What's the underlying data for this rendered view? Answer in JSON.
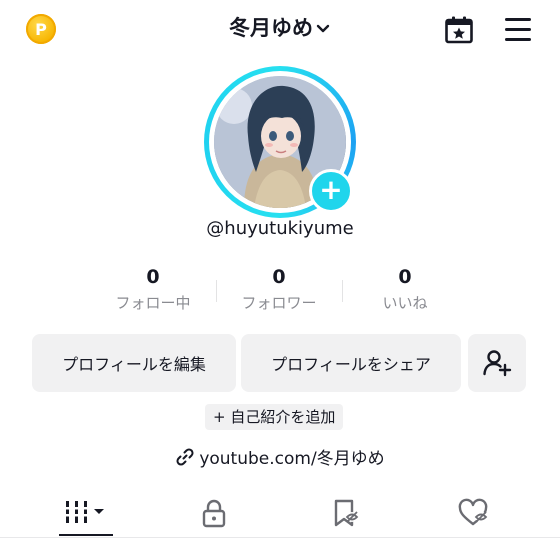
{
  "header": {
    "coin_glyph": "P",
    "title": "冬月ゆめ",
    "icons": [
      "coin-icon",
      "chevron-down-icon",
      "calendar-star-icon",
      "menu-icon"
    ]
  },
  "profile": {
    "username": "@huyutukiyume"
  },
  "stats": [
    {
      "value": "0",
      "label": "フォロー中"
    },
    {
      "value": "0",
      "label": "フォロワー"
    },
    {
      "value": "0",
      "label": "いいね"
    }
  ],
  "buttons": {
    "edit": "プロフィールを編集",
    "share": "プロフィールをシェア"
  },
  "bio": {
    "add_label": "+ 自己紹介を追加"
  },
  "link": {
    "text": "youtube.com/冬月ゆめ"
  },
  "tabs": [
    "videos-grid-icon",
    "lock-icon",
    "bookmark-icon",
    "liked-icon"
  ],
  "colors": {
    "accent": "#20d5ec",
    "coin": "#f7b500",
    "text": "#161823",
    "muted": "#8a8b91",
    "button_bg": "#f1f1f2"
  }
}
